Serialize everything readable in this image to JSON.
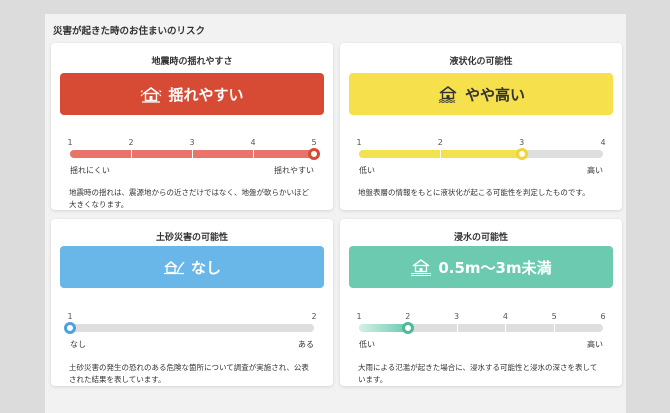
{
  "page": {
    "title": "災害が起きた時のお住まいのリスク"
  },
  "cards": [
    {
      "title": "地震時の揺れやすさ",
      "badge": "揺れやすい",
      "icon": "house-shaking-icon",
      "color": "#d74a33",
      "fill_color": "#e8746a",
      "text_color": "#ffffff",
      "ticks": [
        "1",
        "2",
        "3",
        "4",
        "5"
      ],
      "level": 5,
      "min_label": "揺れにくい",
      "max_label": "揺れやすい",
      "description": "地震時の揺れは、震源地からの近さだけではなく、地盤が軟らかいほど大きくなります。"
    },
    {
      "title": "液状化の可能性",
      "badge": "やや高い",
      "icon": "house-liquefaction-icon",
      "color": "#f6e04b",
      "fill_color": "#f3e250",
      "text_color": "#333333",
      "ticks": [
        "1",
        "2",
        "3",
        "4"
      ],
      "level": 3,
      "min_label": "低い",
      "max_label": "高い",
      "description": "地盤表層の情報をもとに液状化が起こる可能性を判定したものです。"
    },
    {
      "title": "土砂災害の可能性",
      "badge": "なし",
      "icon": "house-landslide-icon",
      "color": "#69b6e8",
      "fill_color": "#69b6e8",
      "text_color": "#ffffff",
      "ticks": [
        "1",
        "2"
      ],
      "level": 1,
      "min_label": "なし",
      "max_label": "ある",
      "description": "土砂災害の発生の恐れのある危険な箇所について調査が実施され、公表された結果を表しています。"
    },
    {
      "title": "浸水の可能性",
      "badge": "0.5m〜3m未満",
      "icon": "house-flood-icon",
      "color": "#6ccab0",
      "fill_color": "#6ccab0",
      "text_color": "#ffffff",
      "ticks": [
        "1",
        "2",
        "3",
        "4",
        "5",
        "6"
      ],
      "level": 2,
      "min_label": "低い",
      "max_label": "高い",
      "description": "大雨による氾濫が起きた場合に、浸水する可能性と浸水の深さを表しています。"
    }
  ]
}
